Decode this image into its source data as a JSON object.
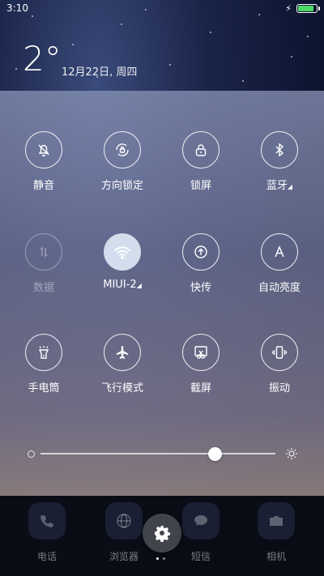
{
  "status": {
    "time": "3:10",
    "battery_level": 0.9,
    "charging_icon": "⚡"
  },
  "weather": {
    "temperature": "2°",
    "date": "12月22日, 周四"
  },
  "tiles": [
    {
      "label": "静音",
      "icon": "bell-off-icon",
      "state": "off"
    },
    {
      "label": "方向锁定",
      "icon": "rotation-lock-icon",
      "state": "off"
    },
    {
      "label": "锁屏",
      "icon": "lock-icon",
      "state": "off"
    },
    {
      "label": "蓝牙",
      "icon": "bluetooth-icon",
      "state": "off",
      "has_expand": true
    },
    {
      "label": "数据",
      "icon": "mobile-data-icon",
      "state": "disabled"
    },
    {
      "label": "MIUI-2",
      "icon": "wifi-icon",
      "state": "on",
      "has_expand": true
    },
    {
      "label": "快传",
      "icon": "quick-transfer-icon",
      "state": "off"
    },
    {
      "label": "自动亮度",
      "icon": "auto-brightness-icon",
      "state": "off"
    },
    {
      "label": "手电筒",
      "icon": "flashlight-icon",
      "state": "off"
    },
    {
      "label": "飞行模式",
      "icon": "airplane-icon",
      "state": "off"
    },
    {
      "label": "截屏",
      "icon": "screenshot-icon",
      "state": "off"
    },
    {
      "label": "振动",
      "icon": "vibrate-icon",
      "state": "off"
    }
  ],
  "brightness": {
    "level": 0.74
  },
  "dock": [
    {
      "label": "电话",
      "icon": "phone-icon"
    },
    {
      "label": "浏览器",
      "icon": "browser-icon"
    },
    {
      "label": "短信",
      "icon": "messages-icon"
    },
    {
      "label": "相机",
      "icon": "camera-icon"
    }
  ],
  "pager": {
    "pages": 2,
    "current": 1
  },
  "colors": {
    "wifi_active": "#dce8f5",
    "battery": "#4cd964"
  }
}
